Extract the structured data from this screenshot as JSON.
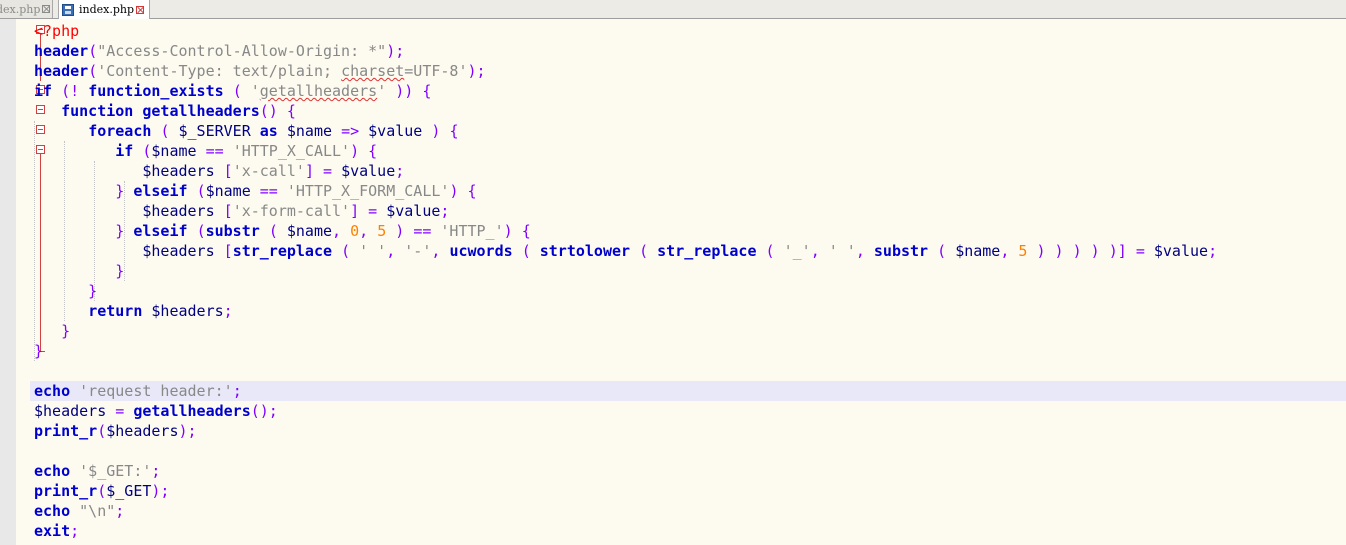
{
  "tabs": [
    {
      "label": "dex.php",
      "active": false
    },
    {
      "label": "index.php",
      "active": true
    }
  ],
  "editor": {
    "colors": {
      "keyword": "#0000cc",
      "string": "#888888",
      "number": "#ff8000",
      "operator": "#8000ff",
      "php_tag": "#ff0000",
      "background": "#fdfbf0",
      "current_line": "#e8e8f8"
    },
    "lines": [
      "<?php",
      "header(\"Access-Control-Allow-Origin: *\");",
      "header('Content-Type: text/plain; charset=UTF-8');",
      "if (! function_exists ( 'getallheaders' )) {",
      "function getallheaders() {",
      "foreach ( $_SERVER as $name => $value ) {",
      "if ($name == 'HTTP_X_CALL') {",
      "$headers ['x-call'] = $value;",
      "} elseif ($name == 'HTTP_X_FORM_CALL') {",
      "$headers ['x-form-call'] = $value;",
      "} elseif (substr ( $name, 0, 5 ) == 'HTTP_') {",
      "$headers [str_replace ( ' ', '-', ucwords ( strtolower ( str_replace ( '_', ' ', substr ( $name, 5 ) ) ) ) )] = $value;",
      "}",
      "}",
      "return $headers;",
      "}",
      "}",
      "",
      "echo 'request header:';",
      "$headers = getallheaders();",
      "print_r($headers);",
      "",
      "echo '$_GET:';",
      "print_r($_GET);",
      "echo \"\\n\";",
      "exit;"
    ]
  }
}
